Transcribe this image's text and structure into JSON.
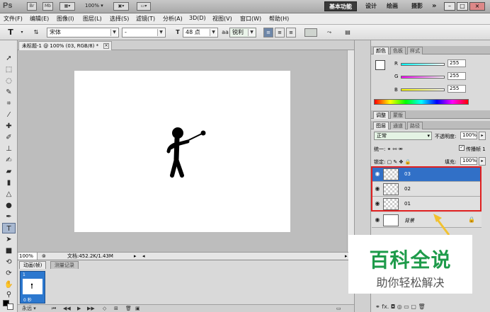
{
  "appbar": {
    "logo": "Ps",
    "icons": [
      "Br",
      "Mb"
    ],
    "zoom": "100%",
    "workspaces": [
      "基本功能",
      "设计",
      "绘画",
      "摄影"
    ],
    "more": "»",
    "win_min": "–",
    "win_max": "□",
    "win_close": "×"
  },
  "menu": [
    "文件(F)",
    "编辑(E)",
    "图像(I)",
    "图层(L)",
    "选择(S)",
    "滤镜(T)",
    "分析(A)",
    "3D(D)",
    "视图(V)",
    "窗口(W)",
    "帮助(H)"
  ],
  "options": {
    "tool_glyph": "T",
    "font_family": "宋体",
    "font_style": "-",
    "font_size": "48 点",
    "aa_label": "a",
    "antialias": "锐利"
  },
  "document": {
    "tab_title": "未标题-1 @ 100% (03, RGB/8) *",
    "zoom": "100%",
    "doc_size": "文档:452.2K/1.43M"
  },
  "animation": {
    "tab_active": "动画(帧)",
    "tab_inactive": "测量记录",
    "frame_number": "1",
    "frame_delay": "0 秒",
    "loop": "永远"
  },
  "color_panel": {
    "tabs": [
      "颜色",
      "色板",
      "样式"
    ],
    "r_label": "R",
    "g_label": "G",
    "b_label": "B",
    "r_value": "255",
    "g_value": "255",
    "b_value": "255"
  },
  "adjust_panel": {
    "tabs": [
      "调整",
      "蒙版"
    ]
  },
  "layers_panel": {
    "tabs": [
      "图层",
      "通道",
      "路径"
    ],
    "blend_mode": "正常",
    "opacity_label": "不透明度:",
    "opacity": "100%",
    "unify_label": "统一:",
    "propagate_label": "传播帧 1",
    "lock_label": "锁定:",
    "fill_label": "填充:",
    "fill": "100%",
    "layers": [
      {
        "name": "03",
        "selected": true
      },
      {
        "name": "02",
        "selected": false
      },
      {
        "name": "01",
        "selected": false
      },
      {
        "name": "背景",
        "selected": false
      }
    ],
    "footer_icons": "fx."
  },
  "watermark": {
    "main": "百科全说",
    "sub": "助你轻松解决"
  },
  "colors": {
    "selection": "#3170c7",
    "highlight_box": "#e02020",
    "watermark_green": "#1e9b4a",
    "arrow": "#f2c230"
  }
}
